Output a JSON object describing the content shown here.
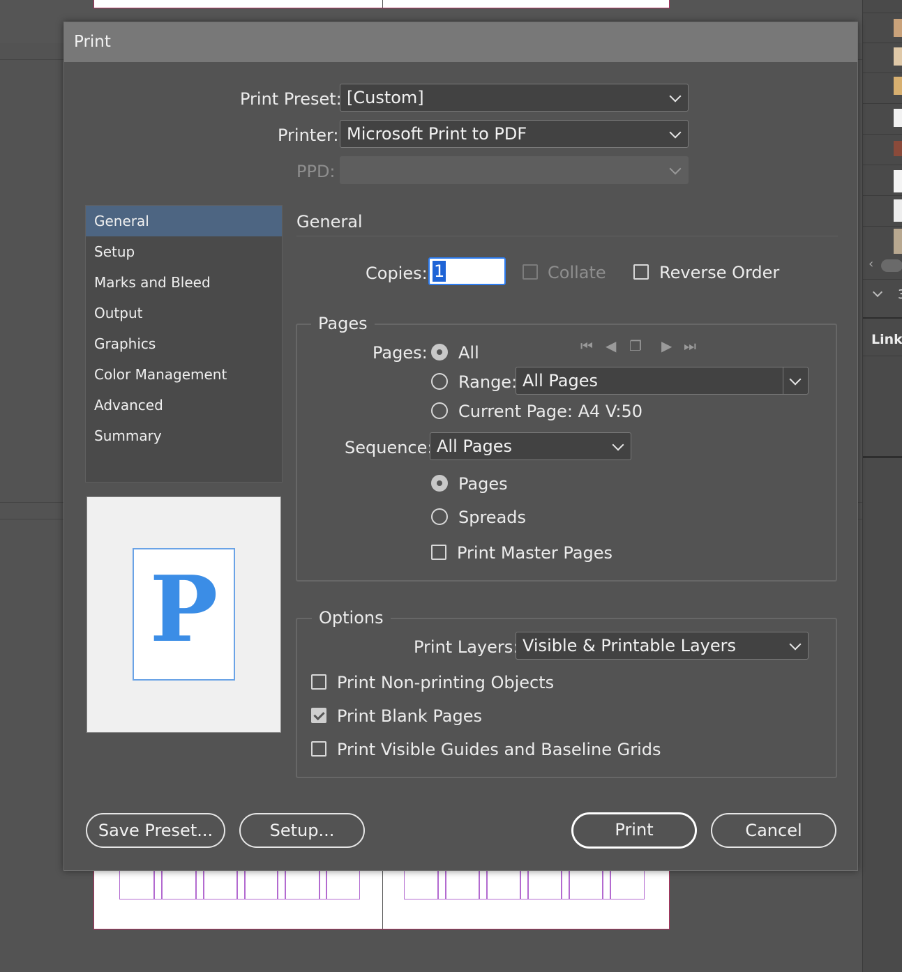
{
  "dialog": {
    "title": "Print"
  },
  "preset": {
    "label": "Print Preset:",
    "value": "[Custom]"
  },
  "printer": {
    "label": "Printer:",
    "value": "Microsoft Print to PDF"
  },
  "ppd": {
    "label": "PPD:",
    "value": ""
  },
  "sidebar": {
    "items": [
      {
        "label": "General",
        "active": true
      },
      {
        "label": "Setup"
      },
      {
        "label": "Marks and Bleed"
      },
      {
        "label": "Output"
      },
      {
        "label": "Graphics"
      },
      {
        "label": "Color Management"
      },
      {
        "label": "Advanced"
      },
      {
        "label": "Summary"
      }
    ]
  },
  "preview": {
    "glyph": "P"
  },
  "general": {
    "title": "General",
    "copies_label": "Copies:",
    "copies_value": "1",
    "collate_label": "Collate",
    "collate_checked": false,
    "reverse_label": "Reverse Order",
    "reverse_checked": false
  },
  "pages": {
    "legend": "Pages",
    "pages_label": "Pages:",
    "all_label": "All",
    "range_label": "Range:",
    "range_value": "All Pages",
    "current_label": "Current Page: A4 V:50",
    "selected": "all",
    "sequence_label": "Sequence:",
    "sequence_value": "All Pages",
    "pages_radio": "Pages",
    "spreads_radio": "Spreads",
    "layout_selected": "pages",
    "master_label": "Print Master Pages",
    "master_checked": false,
    "nav_icons": [
      "first-page-icon",
      "previous-page-icon",
      "page-spread-icon",
      "next-page-icon",
      "last-page-icon"
    ]
  },
  "options": {
    "legend": "Options",
    "layers_label": "Print Layers:",
    "layers_value": "Visible & Printable Layers",
    "nonprinting_label": "Print Non-printing Objects",
    "nonprinting_checked": false,
    "blank_label": "Print Blank Pages",
    "blank_checked": true,
    "guides_label": "Print Visible Guides and Baseline Grids",
    "guides_checked": false
  },
  "buttons": {
    "save_preset": "Save Preset...",
    "setup": "Setup...",
    "print": "Print",
    "cancel": "Cancel"
  },
  "right_panel": {
    "links_tab": "Link",
    "counter": "3"
  }
}
